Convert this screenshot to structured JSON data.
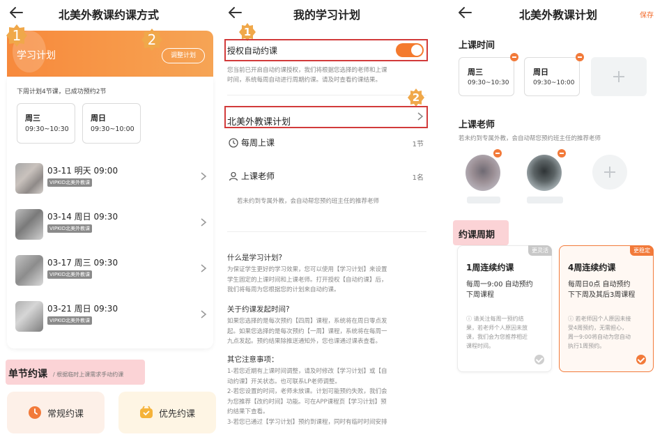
{
  "panel1": {
    "title": "北美外教课约课方式",
    "marker1": "1",
    "marker2": "2",
    "plan_title": "学习计划",
    "adjust_button": "调整计划",
    "summary": "下周计划4节课，已成功预约2节",
    "slots": [
      {
        "day": "周三",
        "time": "09:30~10:30"
      },
      {
        "day": "周日",
        "time": "09:30~10:00"
      }
    ],
    "lessons": [
      {
        "date": "03-11 明天 09:00",
        "tag": "VIPKID北美外教课"
      },
      {
        "date": "03-14 周日 09:30",
        "tag": "VIPKID北美外教课"
      },
      {
        "date": "03-17 周三 09:30",
        "tag": "VIPKID北美外教课"
      },
      {
        "date": "03-21 周日 09:30",
        "tag": "VIPKID北美外教课"
      }
    ],
    "single_title": "单节约课",
    "single_sub": "/ 根据临时上课需求手动约课",
    "regular_button": "常规约课",
    "priority_button": "优先约课"
  },
  "panel2": {
    "title": "我的学习计划",
    "marker1": "1",
    "marker2": "2",
    "auto_label": "授权自动约课",
    "auto_on": true,
    "auto_desc": [
      "您当前已开启自动约课授权，我们将根据您选择的老师和上课",
      "时间，系统每周自动进行周期约课。请及时查看约课结果。"
    ],
    "plan_row": "北美外教课计划",
    "weekly_label": "每周上课",
    "weekly_value": "1节",
    "teacher_label": "上课老师",
    "teacher_value": "1名",
    "teacher_note": "若未约到专属外教，会自动帮您预约班主任的推荐老师",
    "faq": [
      {
        "q": "什么是学习计划?",
        "a": [
          "为保证学生更好的学习效果，您可以使用【学习计划】来设置",
          "学生固定的上课时间和上课老师。打开授权【自动约课】后，",
          "我们将每周为您根据您的计划来自动约课。"
        ]
      },
      {
        "q": "关于约课发起时间?",
        "a": [
          "如果您选择的是每次预约【四周】课程，系统将在周日零点发",
          "起。如果您选择的是每次预约【一周】课程，系统将在每周一",
          "九点发起。预约结果除推送通知外，您也课通过课表查看。"
        ]
      },
      {
        "q": "其它注意事项：",
        "a": [
          "1-若您近期有上课时间调整，请及时修改【学习计划】或【自",
          "动约课】开关状态。也可联系LP老师调整。",
          "2-若您设置的时间，老师未放课。计划可能预约失败，我们会",
          "为您推荐【改约时间】功能。可在APP课程页【学习计划】预",
          "约结果下查看。",
          "3-若您已通过【学习计划】预约到课程，同时有临时时间安排"
        ]
      }
    ]
  },
  "panel3": {
    "title": "北美外教课计划",
    "save": "保存",
    "time_title": "上课时间",
    "slots": [
      {
        "day": "周三",
        "time": "09:30~10:30"
      },
      {
        "day": "周日",
        "time": "09:30~10:00"
      }
    ],
    "teacher_title": "上课老师",
    "teacher_sub": "若未约到专属外教，会自动帮您预约班主任的推荐老师",
    "cycle_title": "约课周期",
    "options": [
      {
        "badge": "更灵活",
        "title": "1周连续约课",
        "desc": [
          "每周一9:00 自动预约",
          "下周课程"
        ],
        "note": [
          "ⓘ 请关注每周一预约结",
          "果，若老师个人原因未放",
          "课，我们会为您推荐相近",
          "课程时间。"
        ],
        "selected": false
      },
      {
        "badge": "更稳定",
        "title": "4周连续约课",
        "desc": [
          "每周日0点 自动预约",
          "下下周及其后3周课程"
        ],
        "note": [
          "ⓘ 若老师因个人原因未接",
          "受4周预约，无需担心，",
          "周一9:00将自动为您自动",
          "执行1周预约。"
        ],
        "selected": true
      }
    ]
  },
  "colors": {
    "accent": "#f47a2e",
    "highlight": "#d23a3a",
    "pink_tag": "#fbd3d6",
    "badge_grey": "#c8c8c8"
  }
}
